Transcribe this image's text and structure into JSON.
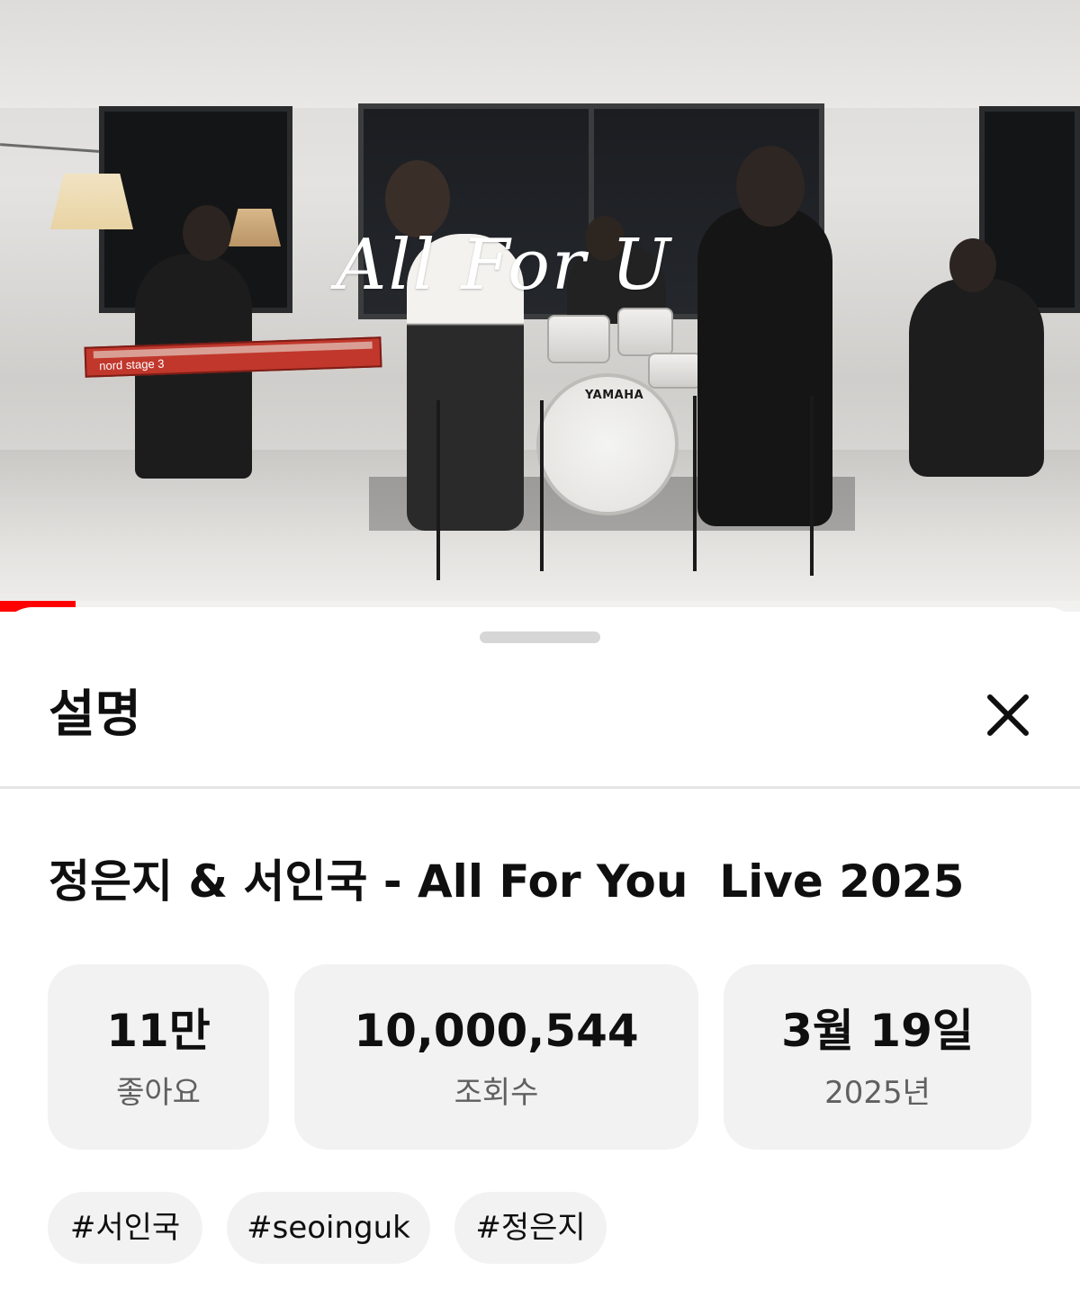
{
  "video": {
    "overlay_title": "All For U",
    "drum_brand": "YAMAHA",
    "keyboard_label": "nord stage 3",
    "progress": 0.07,
    "accent_color": "#ff0000"
  },
  "sheet": {
    "title": "설명",
    "close_icon": "close-icon"
  },
  "video_title": "정은지 & 서인국 - All For You  Live 2025",
  "stats": {
    "likes": {
      "value": "11만",
      "label": "좋아요"
    },
    "views": {
      "value": "10,000,544",
      "label": "조회수"
    },
    "date": {
      "value": "3월 19일",
      "label": "2025년"
    }
  },
  "tags": [
    "#서인국",
    "#seoinguk",
    "#정은지"
  ]
}
